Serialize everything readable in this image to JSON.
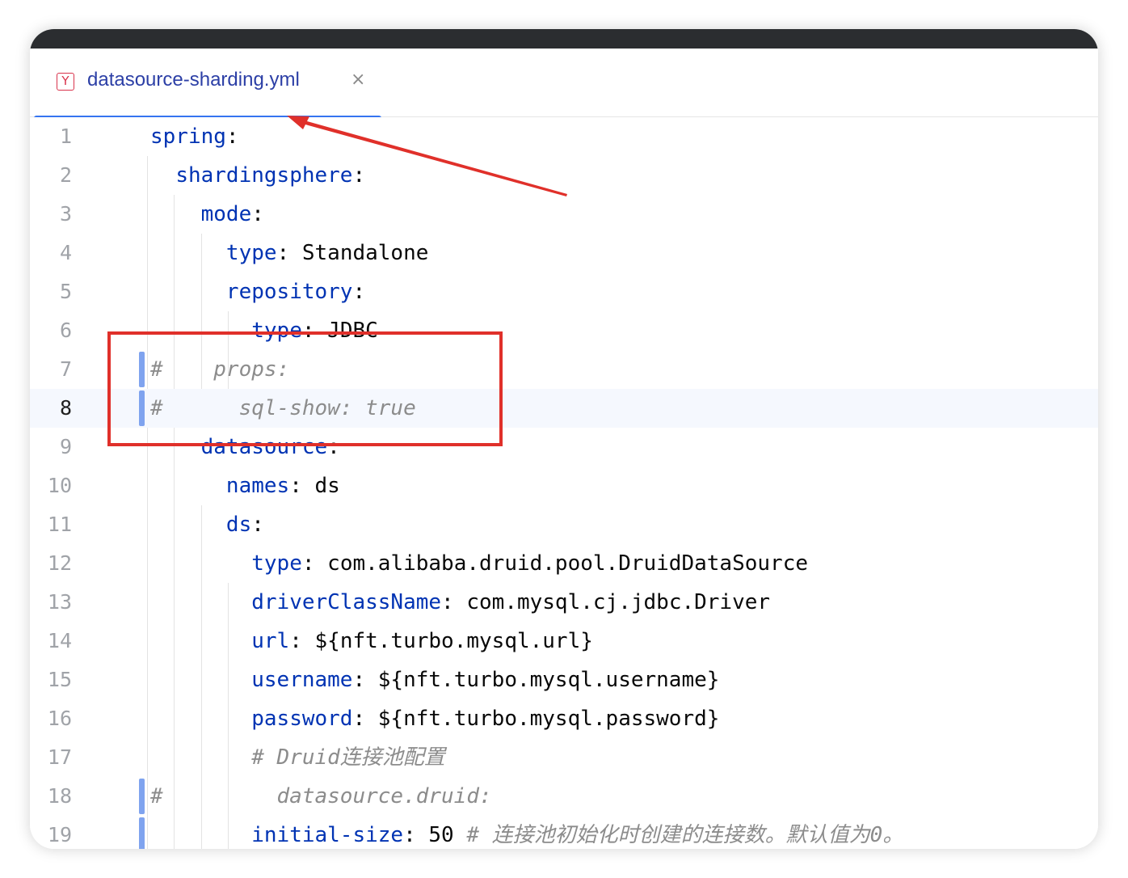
{
  "tab": {
    "icon_letter": "Y",
    "filename": "datasource-sharding.yml",
    "close_glyph": "×"
  },
  "current_line": 8,
  "lines": [
    {
      "num": "1",
      "segs": [
        [
          "k",
          "spring"
        ],
        [
          "p",
          ":"
        ]
      ]
    },
    {
      "num": "2",
      "segs": [
        [
          "p",
          "  "
        ],
        [
          "k",
          "shardingsphere"
        ],
        [
          "p",
          ":"
        ]
      ]
    },
    {
      "num": "3",
      "segs": [
        [
          "p",
          "    "
        ],
        [
          "k",
          "mode"
        ],
        [
          "p",
          ":"
        ]
      ]
    },
    {
      "num": "4",
      "segs": [
        [
          "p",
          "      "
        ],
        [
          "k",
          "type"
        ],
        [
          "p",
          ": "
        ],
        [
          "v",
          "Standalone"
        ]
      ]
    },
    {
      "num": "5",
      "segs": [
        [
          "p",
          "      "
        ],
        [
          "k",
          "repository"
        ],
        [
          "p",
          ":"
        ]
      ]
    },
    {
      "num": "6",
      "segs": [
        [
          "p",
          "        "
        ],
        [
          "k",
          "type"
        ],
        [
          "p",
          ": "
        ],
        [
          "v",
          "JDBC"
        ]
      ]
    },
    {
      "num": "7",
      "segs": [
        [
          "c",
          "#    props:"
        ]
      ],
      "vcs": true
    },
    {
      "num": "8",
      "segs": [
        [
          "c",
          "#      sql-show: true"
        ]
      ],
      "vcs": true
    },
    {
      "num": "9",
      "segs": [
        [
          "p",
          "    "
        ],
        [
          "k",
          "datasource"
        ],
        [
          "p",
          ":"
        ]
      ]
    },
    {
      "num": "10",
      "segs": [
        [
          "p",
          "      "
        ],
        [
          "k",
          "names"
        ],
        [
          "p",
          ": "
        ],
        [
          "v",
          "ds"
        ]
      ]
    },
    {
      "num": "11",
      "segs": [
        [
          "p",
          "      "
        ],
        [
          "k",
          "ds"
        ],
        [
          "p",
          ":"
        ]
      ]
    },
    {
      "num": "12",
      "segs": [
        [
          "p",
          "        "
        ],
        [
          "k",
          "type"
        ],
        [
          "p",
          ": "
        ],
        [
          "v",
          "com.alibaba.druid.pool.DruidDataSource"
        ]
      ]
    },
    {
      "num": "13",
      "segs": [
        [
          "p",
          "        "
        ],
        [
          "k",
          "driverClassName"
        ],
        [
          "p",
          ": "
        ],
        [
          "v",
          "com.mysql.cj.jdbc.Driver"
        ]
      ]
    },
    {
      "num": "14",
      "segs": [
        [
          "p",
          "        "
        ],
        [
          "k",
          "url"
        ],
        [
          "p",
          ": "
        ],
        [
          "v",
          "${nft.turbo.mysql.url}"
        ]
      ]
    },
    {
      "num": "15",
      "segs": [
        [
          "p",
          "        "
        ],
        [
          "k",
          "username"
        ],
        [
          "p",
          ": "
        ],
        [
          "v",
          "${nft.turbo.mysql.username}"
        ]
      ]
    },
    {
      "num": "16",
      "segs": [
        [
          "p",
          "        "
        ],
        [
          "k",
          "password"
        ],
        [
          "p",
          ": "
        ],
        [
          "v",
          "${nft.turbo.mysql.password}"
        ]
      ]
    },
    {
      "num": "17",
      "segs": [
        [
          "p",
          "        "
        ],
        [
          "c",
          "# Druid连接池配置"
        ]
      ]
    },
    {
      "num": "18",
      "segs": [
        [
          "c",
          "#         datasource.druid:"
        ]
      ],
      "vcs": true
    },
    {
      "num": "19",
      "segs": [
        [
          "p",
          "        "
        ],
        [
          "k",
          "initial-size"
        ],
        [
          "p",
          ": "
        ],
        [
          "v",
          "50 "
        ],
        [
          "c",
          "# 连接池初始化时创建的连接数。默认值为0。"
        ]
      ],
      "vcs": true
    }
  ],
  "colors": {
    "keyword": "#0033b3",
    "comment": "#8c8c8c",
    "annotation": "#e0302a",
    "tab_underline": "#3574f0"
  }
}
